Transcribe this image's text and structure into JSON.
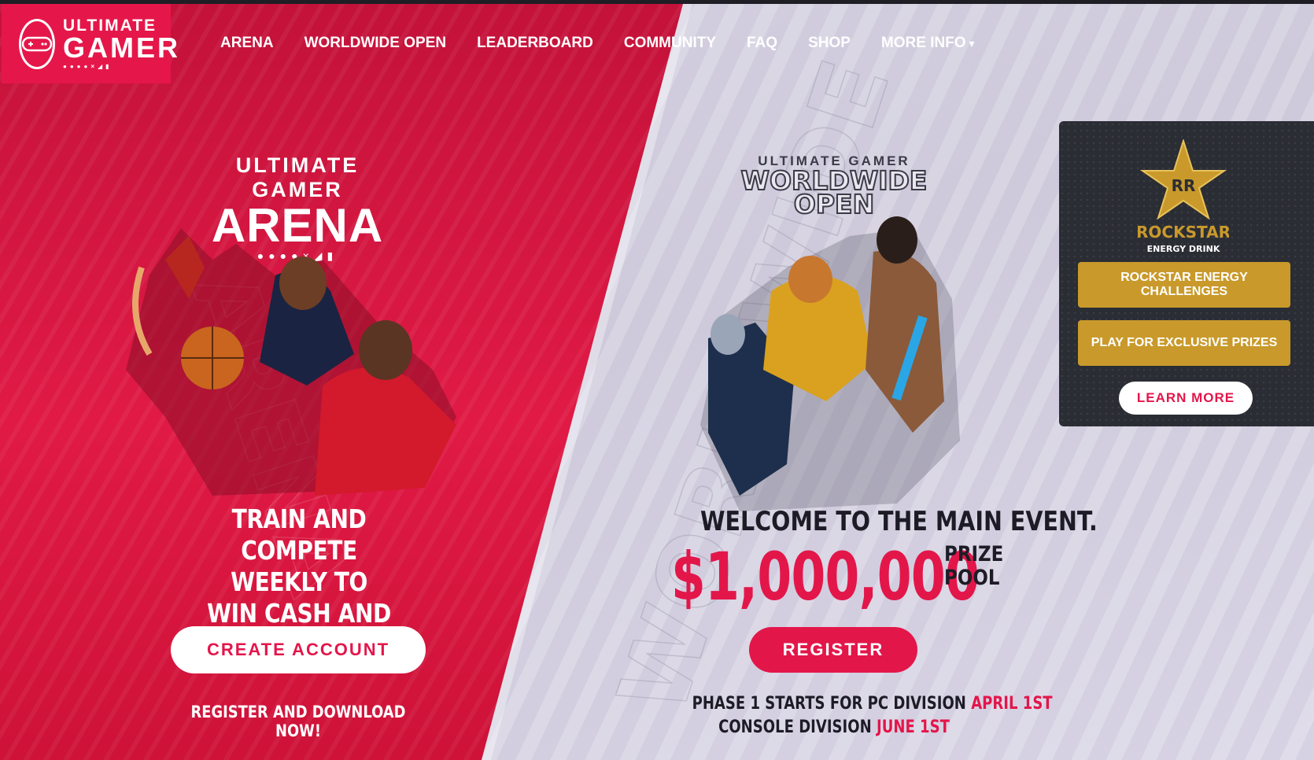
{
  "header": {
    "logo": {
      "line1": "ULTIMATE",
      "line2": "GAMER",
      "line3": "●●●●×◢▮"
    },
    "nav": [
      "ARENA",
      "WORLDWIDE OPEN",
      "LEADERBOARD",
      "COMMUNITY",
      "FAQ",
      "SHOP",
      "MORE INFO"
    ]
  },
  "arena": {
    "logo_small": "ULTIMATE GAMER",
    "logo_big": "ARENA",
    "logo_symbols": "●●●●×◢▮",
    "tagline_lines": [
      "TRAIN AND",
      "COMPETE WEEKLY TO",
      "WIN CASH AND PRIZES"
    ],
    "cta_label": "CREATE ACCOUNT",
    "sub_label": "REGISTER AND DOWNLOAD NOW!"
  },
  "worldwide": {
    "logo_small": "ULTIMATE GAMER",
    "logo_big1": "WORLDWIDE",
    "logo_big2": "OPEN",
    "headline": "WELCOME TO THE MAIN EVENT.",
    "prize_amount": "$1,000,000",
    "prize_label1": "PRIZE",
    "prize_label2": "POOL",
    "cta_label": "REGISTER",
    "phase1_text": "PHASE 1 STARTS FOR PC DIVISION",
    "phase1_date": "APRIL 1ST",
    "phase2_text": "CONSOLE DIVISION",
    "phase2_date": "JUNE 1ST"
  },
  "sponsor": {
    "brand": "ROCKSTAR",
    "brand_sub": "ENERGY DRINK",
    "button1": "ROCKSTAR ENERGY CHALLENGES",
    "button2": "PLAY FOR EXCLUSIVE PRIZES",
    "learn_more": "LEARN MORE"
  },
  "colors": {
    "brand_red": "#e3164a",
    "gold": "#c99a2b",
    "panel_dark": "#2b2d34",
    "text_dark": "#1d1c26"
  },
  "icons": [
    "gamepad-icon",
    "chevron-down-icon",
    "star-icon"
  ]
}
